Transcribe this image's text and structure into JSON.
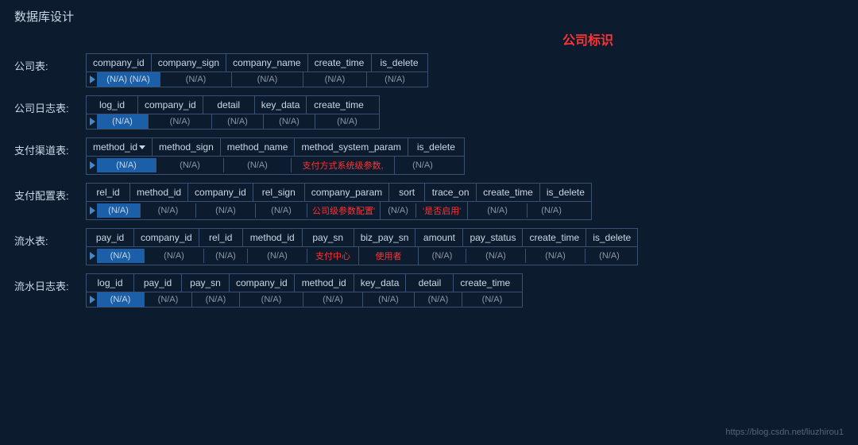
{
  "page": {
    "title": "数据库设计",
    "main_label": "公司标识",
    "bottom_link": "https://blog.csdn.net/liuzhirou1"
  },
  "tables": [
    {
      "label": "公司表:",
      "headers": [
        "company_id",
        "company_sign",
        "company_name",
        "create_time",
        "is_delete"
      ],
      "header_widths": [
        80,
        90,
        90,
        80,
        70
      ],
      "has_arrow": [
        false,
        false,
        false,
        false,
        false
      ],
      "cells": [
        "(N/A) (N/A)",
        "(N/A)",
        "(N/A)",
        "(N/A)",
        "(N/A)"
      ],
      "first_cell_blue": true
    },
    {
      "label": "公司日志表:",
      "headers": [
        "log_id",
        "company_id",
        "detail",
        "key_data",
        "create_time"
      ],
      "header_widths": [
        65,
        80,
        65,
        65,
        80
      ],
      "has_arrow": [
        false,
        false,
        false,
        false,
        false
      ],
      "cells": [
        "(N/A)",
        "(N/A)",
        "(N/A)",
        "(N/A)",
        "(N/A)"
      ],
      "first_cell_blue": true
    },
    {
      "label": "支付渠道表:",
      "headers": [
        "method_id",
        "method_sign",
        "method_name",
        "method_system_param",
        "is_delete"
      ],
      "header_widths": [
        75,
        85,
        85,
        130,
        70
      ],
      "has_arrow": [
        true,
        false,
        false,
        false,
        false
      ],
      "cells": [
        "(N/A)",
        "(N/A)",
        "(N/A)",
        "支付方式系统级参数,",
        "(N/A)"
      ],
      "first_cell_blue": true,
      "cell_red": [
        3
      ]
    },
    {
      "label": "支付配置表:",
      "headers": [
        "rel_id",
        "method_id",
        "company_id",
        "rel_sign",
        "company_param",
        "sort",
        "trace_on",
        "create_time",
        "is_delete"
      ],
      "header_widths": [
        55,
        70,
        75,
        65,
        90,
        45,
        65,
        75,
        60
      ],
      "has_arrow": [
        false,
        false,
        false,
        false,
        false,
        false,
        false,
        false,
        false
      ],
      "cells": [
        "(N/A)",
        "(N/A)",
        "(N/A)",
        "(N/A)",
        "公司级参数配置'",
        "(N/A)",
        "'是否启用'",
        "(N/A)",
        "(N/A)"
      ],
      "first_cell_blue": true,
      "cell_red": [
        4,
        6
      ]
    },
    {
      "label": "流水表:",
      "headers": [
        "pay_id",
        "company_id",
        "rel_id",
        "method_id",
        "pay_sn",
        "biz_pay_sn",
        "amount",
        "pay_status",
        "create_time",
        "is_delete"
      ],
      "header_widths": [
        60,
        75,
        55,
        75,
        65,
        75,
        60,
        75,
        75,
        60
      ],
      "has_arrow": [
        false,
        false,
        false,
        false,
        false,
        false,
        false,
        false,
        false,
        false
      ],
      "cells": [
        "(N/A)",
        "(N/A)",
        "(N/A)",
        "(N/A)",
        "支付中心",
        "使用者",
        "(N/A)",
        "(N/A)",
        "(N/A)",
        "(N/A)"
      ],
      "first_cell_blue": true,
      "cell_red": [
        4,
        5
      ]
    },
    {
      "label": "流水日志表:",
      "headers": [
        "log_id",
        "pay_id",
        "pay_sn",
        "company_id",
        "method_id",
        "key_data",
        "detail",
        "create_time"
      ],
      "header_widths": [
        60,
        60,
        60,
        80,
        75,
        65,
        60,
        75
      ],
      "has_arrow": [
        false,
        false,
        false,
        false,
        false,
        false,
        false,
        false
      ],
      "cells": [
        "(N/A)",
        "(N/A)",
        "(N/A)",
        "(N/A)",
        "(N/A)",
        "(N/A)",
        "(N/A)",
        "(N/A)"
      ],
      "first_cell_blue": true
    }
  ]
}
